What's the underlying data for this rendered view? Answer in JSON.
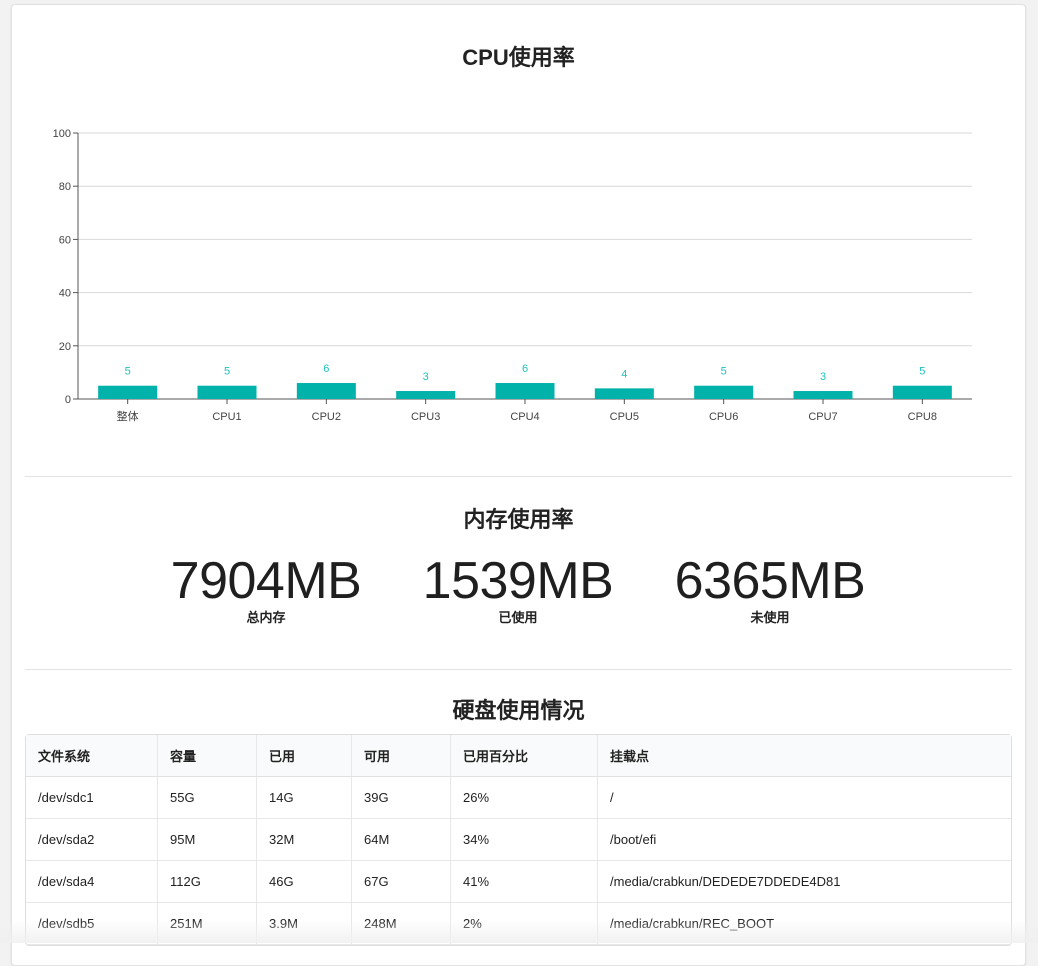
{
  "cpu_section": {
    "title": "CPU使用率"
  },
  "chart_data": {
    "type": "bar",
    "categories": [
      "整体",
      "CPU1",
      "CPU2",
      "CPU3",
      "CPU4",
      "CPU5",
      "CPU6",
      "CPU7",
      "CPU8"
    ],
    "values": [
      5,
      5,
      6,
      3,
      6,
      4,
      5,
      3,
      5
    ],
    "ylim": [
      0,
      100
    ],
    "yticks": [
      0,
      20,
      40,
      60,
      80,
      100
    ],
    "grid": true,
    "bar_color": "#00b2a9",
    "label_color": "#1fbfbf"
  },
  "memory_section": {
    "title": "内存使用率",
    "stats": [
      {
        "value": "7904MB",
        "label": "总内存"
      },
      {
        "value": "1539MB",
        "label": "已使用"
      },
      {
        "value": "6365MB",
        "label": "未使用"
      }
    ]
  },
  "disk_section": {
    "title": "硬盘使用情况",
    "columns": [
      "文件系统",
      "容量",
      "已用",
      "可用",
      "已用百分比",
      "挂载点"
    ],
    "rows": [
      [
        "/dev/sdc1",
        "55G",
        "14G",
        "39G",
        "26%",
        "/"
      ],
      [
        "/dev/sda2",
        "95M",
        "32M",
        "64M",
        "34%",
        "/boot/efi"
      ],
      [
        "/dev/sda4",
        "112G",
        "46G",
        "67G",
        "41%",
        "/media/crabkun/DEDEDE7DDEDE4D81"
      ],
      [
        "/dev/sdb5",
        "251M",
        "3.9M",
        "248M",
        "2%",
        "/media/crabkun/REC_BOOT"
      ]
    ]
  }
}
